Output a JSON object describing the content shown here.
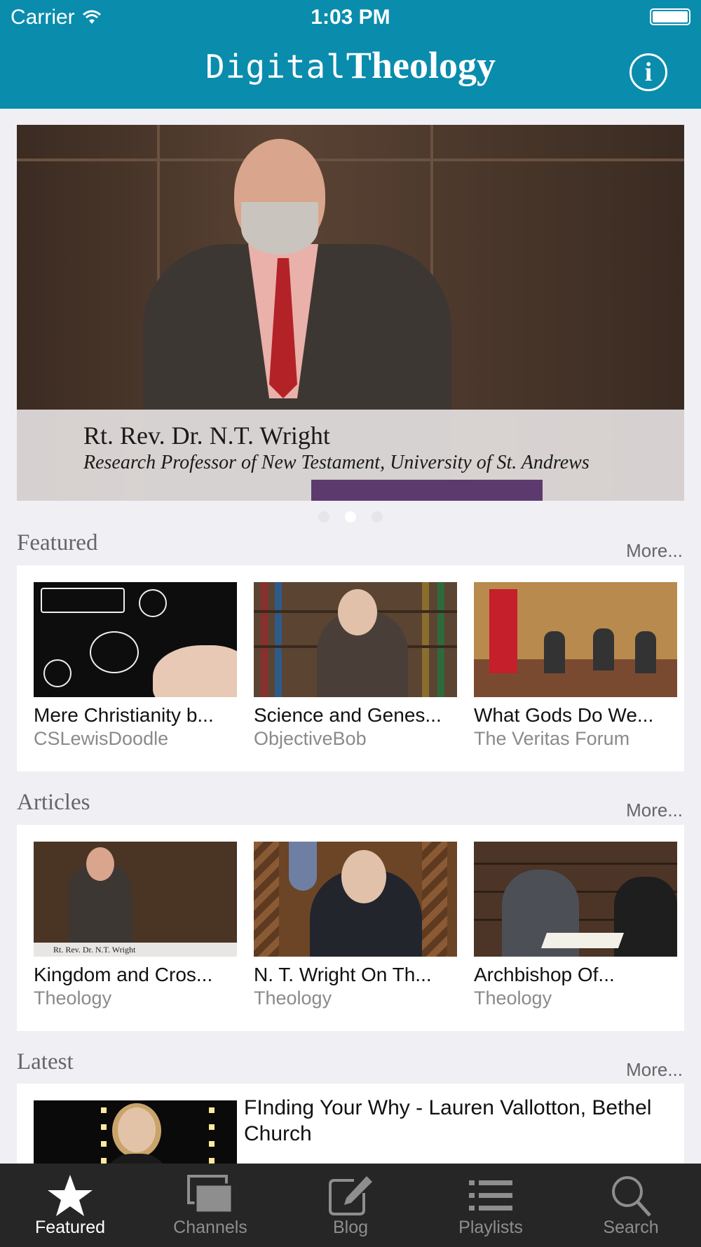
{
  "status_bar": {
    "carrier": "Carrier",
    "time": "1:03 PM"
  },
  "header": {
    "title_part1": "Digital",
    "title_part2": "Theology",
    "info_label": "i"
  },
  "hero": {
    "name": "Rt. Rev. Dr. N.T. Wright",
    "role": "Research Professor of New Testament, University of St. Andrews",
    "page_count": 3,
    "active_page": 2
  },
  "featured": {
    "title": "Featured",
    "more": "More...",
    "items": [
      {
        "title": "Mere Christianity b...",
        "subtitle": "CSLewisDoodle"
      },
      {
        "title": "Science and Genes...",
        "subtitle": "ObjectiveBob"
      },
      {
        "title": "What Gods Do We...",
        "subtitle": "The Veritas Forum"
      }
    ]
  },
  "articles": {
    "title": "Articles",
    "more": "More...",
    "thumb_caption": "Rt. Rev. Dr. N.T. Wright",
    "items": [
      {
        "title": "Kingdom and Cros...",
        "subtitle": "Theology"
      },
      {
        "title": "N. T. Wright On Th...",
        "subtitle": "Theology"
      },
      {
        "title": "Archbishop Of...",
        "subtitle": "Theology"
      }
    ]
  },
  "latest": {
    "title": "Latest",
    "more": "More...",
    "items": [
      {
        "title": "FInding Your Why - Lauren Vallotton, Bethel Church"
      }
    ]
  },
  "tabbar": {
    "tabs": [
      {
        "label": "Featured",
        "icon": "star-icon",
        "active": true
      },
      {
        "label": "Channels",
        "icon": "channels-icon",
        "active": false
      },
      {
        "label": "Blog",
        "icon": "compose-icon",
        "active": false
      },
      {
        "label": "Playlists",
        "icon": "list-icon",
        "active": false
      },
      {
        "label": "Search",
        "icon": "search-icon",
        "active": false
      }
    ]
  },
  "colors": {
    "brand": "#0a8cad",
    "tabbar_bg": "#262626",
    "page_bg": "#efeff4"
  }
}
